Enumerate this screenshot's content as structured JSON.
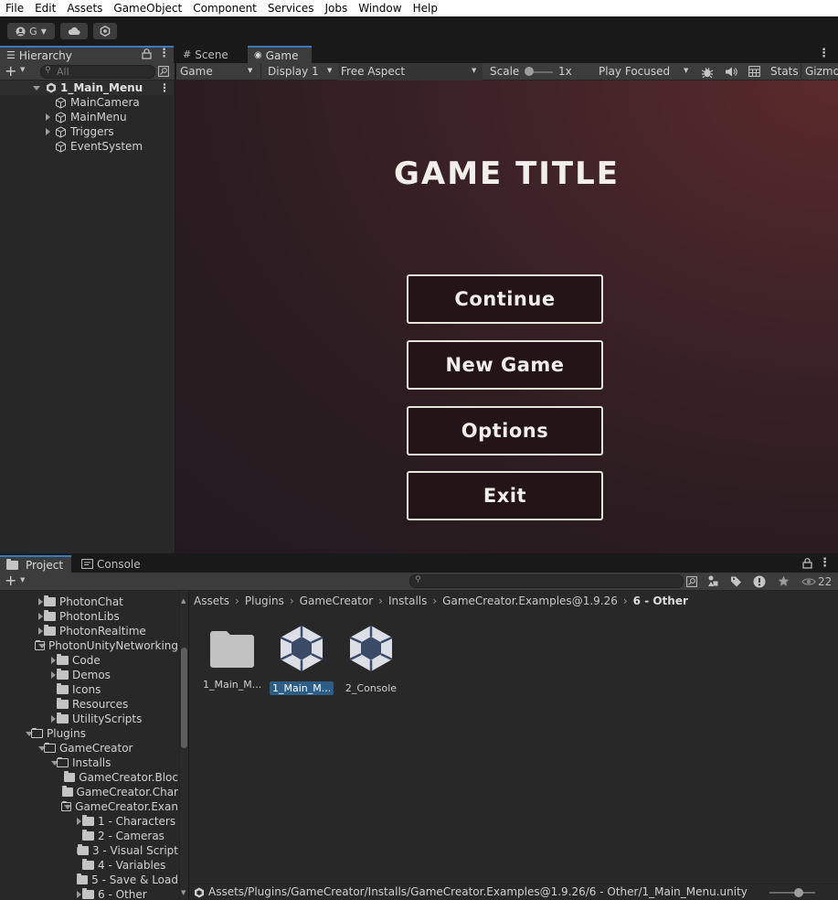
{
  "menu": [
    "File",
    "Edit",
    "Assets",
    "GameObject",
    "Component",
    "Services",
    "Jobs",
    "Window",
    "Help"
  ],
  "toolbar": {
    "account_label": "G"
  },
  "hierarchy": {
    "tab_label": "Hierarchy",
    "search_placeholder": "All",
    "scene_name": "1_Main_Menu",
    "items": [
      {
        "label": "MainCamera",
        "expandable": false
      },
      {
        "label": "MainMenu",
        "expandable": true
      },
      {
        "label": "Triggers",
        "expandable": true
      },
      {
        "label": "EventSystem",
        "expandable": false
      }
    ]
  },
  "scene_tabs": {
    "scene": "Scene",
    "game": "Game"
  },
  "game_toolbar": {
    "mode": "Game",
    "display": "Display 1",
    "aspect": "Free Aspect",
    "scale_label": "Scale",
    "scale_value": "1x",
    "play_mode": "Play Focused",
    "stats": "Stats",
    "gizmos": "Gizmo"
  },
  "game": {
    "title": "GAME TITLE",
    "buttons": [
      "Continue",
      "New Game",
      "Options",
      "Exit"
    ]
  },
  "project": {
    "tab_project": "Project",
    "tab_console": "Console",
    "hidden_count": "22",
    "tree": [
      {
        "label": "PhotonChat",
        "indent": 1,
        "state": "closed"
      },
      {
        "label": "PhotonLibs",
        "indent": 1,
        "state": "closed"
      },
      {
        "label": "PhotonRealtime",
        "indent": 1,
        "state": "closed"
      },
      {
        "label": "PhotonUnityNetworking",
        "indent": 1,
        "state": "open"
      },
      {
        "label": "Code",
        "indent": 2,
        "state": "closed"
      },
      {
        "label": "Demos",
        "indent": 2,
        "state": "closed"
      },
      {
        "label": "Icons",
        "indent": 2,
        "state": "none"
      },
      {
        "label": "Resources",
        "indent": 2,
        "state": "none"
      },
      {
        "label": "UtilityScripts",
        "indent": 2,
        "state": "closed"
      },
      {
        "label": "Plugins",
        "indent": 0,
        "state": "open"
      },
      {
        "label": "GameCreator",
        "indent": 1,
        "state": "open"
      },
      {
        "label": "Installs",
        "indent": 2,
        "state": "open"
      },
      {
        "label": "GameCreator.Bloc",
        "indent": 3,
        "state": "closed"
      },
      {
        "label": "GameCreator.Char",
        "indent": 3,
        "state": "closed"
      },
      {
        "label": "GameCreator.Exan",
        "indent": 3,
        "state": "open"
      },
      {
        "label": "1 - Characters",
        "indent": 4,
        "state": "closed"
      },
      {
        "label": "2 - Cameras",
        "indent": 4,
        "state": "none"
      },
      {
        "label": "3 - Visual Script",
        "indent": 4,
        "state": "closed"
      },
      {
        "label": "4 - Variables",
        "indent": 4,
        "state": "none"
      },
      {
        "label": "5 - Save & Load",
        "indent": 4,
        "state": "none"
      },
      {
        "label": "6 - Other",
        "indent": 4,
        "state": "closed"
      }
    ],
    "breadcrumb": [
      "Assets",
      "Plugins",
      "GameCreator",
      "Installs",
      "GameCreator.Examples@1.9.26",
      "6 - Other"
    ],
    "assets": [
      {
        "label": "1_Main_M...",
        "kind": "folder",
        "selected": false
      },
      {
        "label": "1_Main_M...",
        "kind": "unity",
        "selected": true
      },
      {
        "label": "2_Console",
        "kind": "unity",
        "selected": false
      }
    ],
    "status_path": "Assets/Plugins/GameCreator/Installs/GameCreator.Examples@1.9.26/6 - Other/1_Main_Menu.unity"
  },
  "colors": {
    "accent": "#3a79bb",
    "selection": "#2c5d87",
    "panel": "#282828",
    "toolbar": "#3c3c3c"
  }
}
